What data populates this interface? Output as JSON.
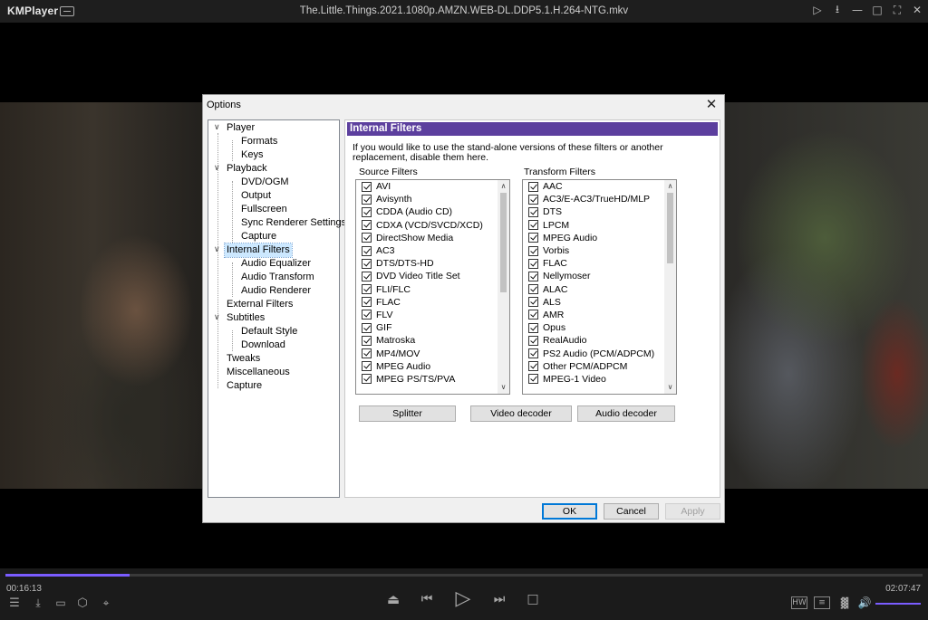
{
  "app": {
    "name": "KMPlayer",
    "file_title": "The.Little.Things.2021.1080p.AMZN.WEB-DL.DDP5.1.H.264-NTG.mkv"
  },
  "window_icons": [
    "cast-icon",
    "pin-icon",
    "minimize-icon",
    "maximize-icon",
    "fullscreen-icon",
    "close-icon"
  ],
  "playback": {
    "current_time": "00:16:13",
    "total_time": "02:07:47",
    "progress": 0.135,
    "volume": 1.0
  },
  "dialog": {
    "title": "Options",
    "close_glyph": "✕",
    "tree": [
      {
        "label": "Player",
        "level": 0,
        "expanded": true
      },
      {
        "label": "Formats",
        "level": 1
      },
      {
        "label": "Keys",
        "level": 1
      },
      {
        "label": "Playback",
        "level": 0,
        "expanded": true
      },
      {
        "label": "DVD/OGM",
        "level": 1
      },
      {
        "label": "Output",
        "level": 1
      },
      {
        "label": "Fullscreen",
        "level": 1
      },
      {
        "label": "Sync Renderer Settings",
        "level": 1
      },
      {
        "label": "Capture",
        "level": 1
      },
      {
        "label": "Internal Filters",
        "level": 0,
        "expanded": true,
        "selected": true
      },
      {
        "label": "Audio Equalizer",
        "level": 1
      },
      {
        "label": "Audio Transform",
        "level": 1
      },
      {
        "label": "Audio Renderer",
        "level": 1
      },
      {
        "label": "External Filters",
        "level": 0
      },
      {
        "label": "Subtitles",
        "level": 0,
        "expanded": true
      },
      {
        "label": "Default Style",
        "level": 1
      },
      {
        "label": "Download",
        "level": 1
      },
      {
        "label": "Tweaks",
        "level": 0
      },
      {
        "label": "Miscellaneous",
        "level": 0
      },
      {
        "label": "Capture",
        "level": 0
      }
    ],
    "panel": {
      "heading": "Internal Filters",
      "description": "If you would like to use the stand-alone versions of these filters or another replacement, disable them here.",
      "source_filters": {
        "label": "Source Filters",
        "items": [
          {
            "label": "AVI",
            "checked": true
          },
          {
            "label": "Avisynth",
            "checked": true
          },
          {
            "label": "CDDA (Audio CD)",
            "checked": true
          },
          {
            "label": "CDXA (VCD/SVCD/XCD)",
            "checked": true
          },
          {
            "label": "DirectShow Media",
            "checked": true
          },
          {
            "label": "AC3",
            "checked": true
          },
          {
            "label": "DTS/DTS-HD",
            "checked": true
          },
          {
            "label": "DVD Video Title Set",
            "checked": true
          },
          {
            "label": "FLI/FLC",
            "checked": true
          },
          {
            "label": "FLAC",
            "checked": true
          },
          {
            "label": "FLV",
            "checked": true
          },
          {
            "label": "GIF",
            "checked": true
          },
          {
            "label": "Matroska",
            "checked": true
          },
          {
            "label": "MP4/MOV",
            "checked": true
          },
          {
            "label": "MPEG Audio",
            "checked": true
          },
          {
            "label": "MPEG PS/TS/PVA",
            "checked": true
          }
        ]
      },
      "transform_filters": {
        "label": "Transform Filters",
        "items": [
          {
            "label": "AAC",
            "checked": true
          },
          {
            "label": "AC3/E-AC3/TrueHD/MLP",
            "checked": true
          },
          {
            "label": "DTS",
            "checked": true
          },
          {
            "label": "LPCM",
            "checked": true
          },
          {
            "label": "MPEG Audio",
            "checked": true
          },
          {
            "label": "Vorbis",
            "checked": true
          },
          {
            "label": "FLAC",
            "checked": true
          },
          {
            "label": "Nellymoser",
            "checked": true
          },
          {
            "label": "ALAC",
            "checked": true
          },
          {
            "label": "ALS",
            "checked": true
          },
          {
            "label": "AMR",
            "checked": true
          },
          {
            "label": "Opus",
            "checked": true
          },
          {
            "label": "RealAudio",
            "checked": true
          },
          {
            "label": "PS2 Audio (PCM/ADPCM)",
            "checked": true
          },
          {
            "label": "Other PCM/ADPCM",
            "checked": true
          },
          {
            "label": "MPEG-1 Video",
            "checked": true
          }
        ]
      },
      "buttons": {
        "splitter": "Splitter",
        "video_decoder": "Video decoder",
        "audio_decoder": "Audio decoder"
      }
    },
    "footer": {
      "ok": "OK",
      "cancel": "Cancel",
      "apply": "Apply"
    }
  },
  "colors": {
    "accent": "#7a5cff",
    "panel_header": "#5c3f9e",
    "tree_selection": "#cce8ff"
  }
}
